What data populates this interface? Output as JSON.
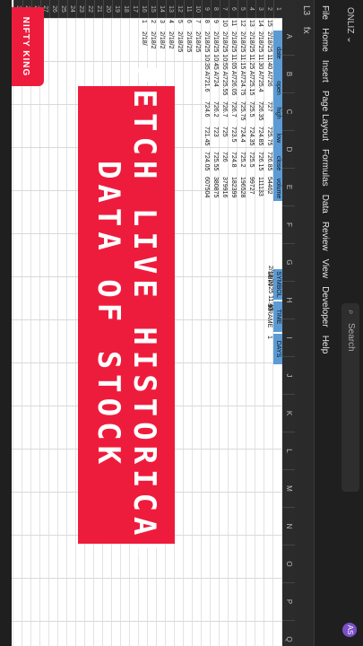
{
  "window": {
    "title": "ONLIZ ⌄",
    "search_placeholder": "Search",
    "avatar": "AS"
  },
  "ribbon_tabs": [
    "File",
    "Home",
    "Insert",
    "Page Layout",
    "Formulas",
    "Data",
    "Review",
    "View",
    "Developer",
    "Help"
  ],
  "formula_bar": {
    "name_box": "L3",
    "fx": "fx"
  },
  "columns": [
    "A",
    "B",
    "C",
    "D",
    "E",
    "F",
    "G",
    "H",
    "I",
    "J",
    "K",
    "L",
    "M",
    "N",
    "O",
    "P",
    "Q"
  ],
  "rows": [
    "1",
    "2",
    "3",
    "4",
    "5",
    "6",
    "7",
    "8",
    "9",
    "10",
    "11",
    "12",
    "13",
    "14",
    "15",
    "16",
    "17",
    "18",
    "19",
    "20",
    "21",
    "22",
    "23",
    "24",
    "25",
    "26",
    "27",
    "28",
    "29",
    "30"
  ],
  "table": {
    "headers": [
      "date",
      "open",
      "high",
      "low",
      "close",
      "volume"
    ],
    "index_col": [
      "15",
      "14",
      "13",
      "12",
      "11",
      "10",
      "9",
      "8",
      "7",
      "6",
      "5",
      "4",
      "3",
      "2",
      "1",
      "0"
    ],
    "rows": [
      [
        "2/18/25 11:40 AM",
        "726",
        "727",
        "725.75",
        "726.85",
        "54462"
      ],
      [
        "2/18/25 11:30 AM",
        "725.4",
        "726.35",
        "724.85",
        "726.15",
        "111133"
      ],
      [
        "2/18/25 11:25 AM",
        "725.15",
        "725.5",
        "724.35",
        "725.5",
        "99727"
      ],
      [
        "2/18/25 11:15 AM",
        "724.75",
        "725.75",
        "724.4",
        "725.2",
        "196528"
      ],
      [
        "2/18/25 11:05 AM",
        "726.05",
        "726.7",
        "723.5",
        "724.8",
        "182399"
      ],
      [
        "2/18/25 10:55 AM",
        "725.55",
        "726.7",
        "725",
        "726",
        "379916"
      ],
      [
        "2/18/25 10:45 AM",
        "724",
        "726.2",
        "723",
        "725.55",
        "380875"
      ],
      [
        "2/18/25 10:35 AM",
        "721.6",
        "724.6",
        "721.45",
        "724.05",
        "607504"
      ],
      [
        "2/18/25",
        "",
        "",
        "",
        "",
        ""
      ],
      [
        "2/18/25",
        "",
        "",
        "",
        "",
        ""
      ],
      [
        "2/18/25",
        "",
        "",
        "",
        "",
        ""
      ],
      [
        "2/18/2",
        "",
        "",
        "",
        "",
        ""
      ],
      [
        "2/18/2",
        "",
        "",
        "",
        "",
        ""
      ],
      [
        "2/18/2",
        "",
        "",
        "",
        "",
        ""
      ],
      [
        "2/18/",
        "",
        "",
        "",
        "",
        ""
      ]
    ]
  },
  "timestamp": "2/18/2025 11:47",
  "params": {
    "headers": [
      "SYMBOL",
      "TIME FRAME",
      "DAYS"
    ],
    "values": [
      "SBIN",
      "10",
      "1"
    ]
  },
  "overlay": {
    "line1": "FETCH LIVE HISTORICAL",
    "line2": "DATA OF STOCK",
    "brand": "NIFTY KING"
  },
  "colors": {
    "banner": "#ee1c3c",
    "header": "#5b9bd5"
  }
}
